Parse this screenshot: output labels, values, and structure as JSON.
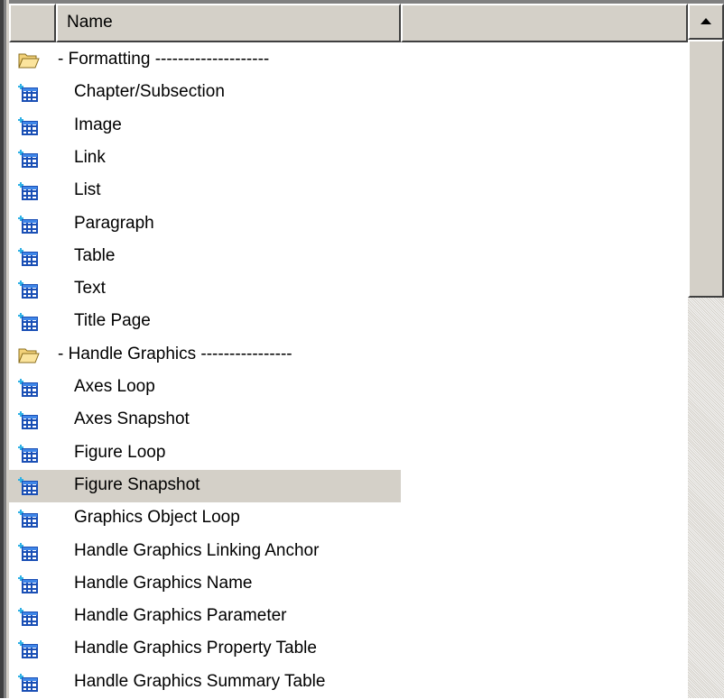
{
  "header": {
    "columns": [
      {
        "label": ""
      },
      {
        "label": "Name"
      },
      {
        "label": ""
      }
    ]
  },
  "rows": [
    {
      "label": "- Formatting --------------------",
      "type": "folder",
      "icon": "folder-icon"
    },
    {
      "label": "Chapter/Subsection",
      "type": "component",
      "icon": "component-grid-icon"
    },
    {
      "label": "Image",
      "type": "component",
      "icon": "component-grid-icon"
    },
    {
      "label": "Link",
      "type": "component",
      "icon": "component-grid-icon"
    },
    {
      "label": "List",
      "type": "component",
      "icon": "component-grid-icon"
    },
    {
      "label": "Paragraph",
      "type": "component",
      "icon": "component-grid-icon"
    },
    {
      "label": "Table",
      "type": "component",
      "icon": "component-grid-icon"
    },
    {
      "label": "Text",
      "type": "component",
      "icon": "component-grid-icon"
    },
    {
      "label": "Title Page",
      "type": "component",
      "icon": "component-grid-icon"
    },
    {
      "label": "- Handle Graphics ----------------",
      "type": "folder",
      "icon": "folder-icon"
    },
    {
      "label": "Axes Loop",
      "type": "component",
      "icon": "component-grid-icon"
    },
    {
      "label": "Axes Snapshot",
      "type": "component",
      "icon": "component-grid-icon"
    },
    {
      "label": "Figure Loop",
      "type": "component",
      "icon": "component-grid-icon"
    },
    {
      "label": "Figure Snapshot",
      "type": "component",
      "icon": "component-grid-icon",
      "selected": true
    },
    {
      "label": "Graphics Object Loop",
      "type": "component",
      "icon": "component-grid-icon"
    },
    {
      "label": "Handle Graphics Linking Anchor",
      "type": "component",
      "icon": "component-grid-icon"
    },
    {
      "label": "Handle Graphics Name",
      "type": "component",
      "icon": "component-grid-icon"
    },
    {
      "label": "Handle Graphics Parameter",
      "type": "component",
      "icon": "component-grid-icon"
    },
    {
      "label": "Handle Graphics Property Table",
      "type": "component",
      "icon": "component-grid-icon"
    },
    {
      "label": "Handle Graphics Summary Table",
      "type": "component",
      "icon": "component-grid-icon"
    }
  ],
  "scrollbar": {
    "up_arrow_icon": "up-arrow-icon",
    "position": 0
  },
  "colors": {
    "selection": "#d4d0c8",
    "folder": "#f7d36b",
    "grid_icon": "#2a6fe0"
  }
}
